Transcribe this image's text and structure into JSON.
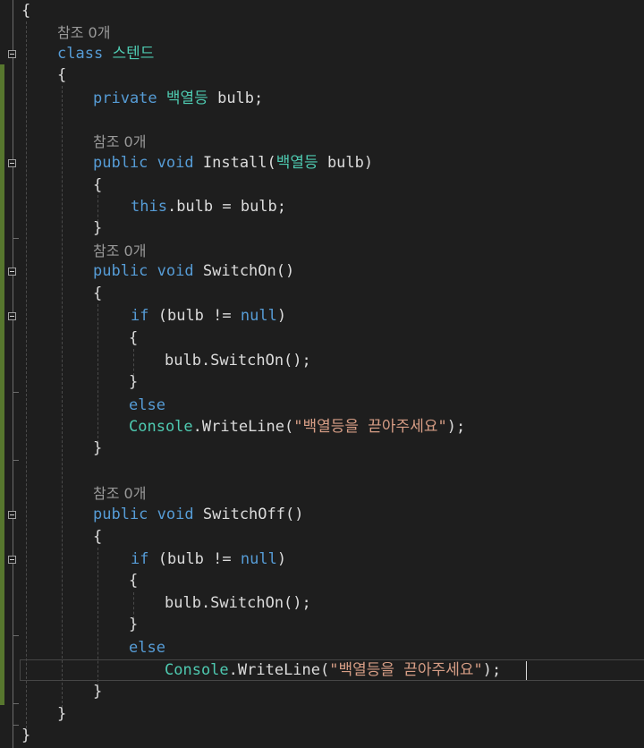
{
  "editor": {
    "codelens_text": "참조 0개",
    "lines": [
      {
        "text": "{"
      },
      {
        "text": "참조 0개"
      },
      {
        "text": "class 스텐드"
      },
      {
        "text": "{"
      },
      {
        "text": "private 백열등 bulb;"
      },
      {
        "text": ""
      },
      {
        "text": "참조 0개"
      },
      {
        "text": "public void Install(백열등 bulb)"
      },
      {
        "text": "{"
      },
      {
        "text": "this.bulb = bulb;"
      },
      {
        "text": "}"
      },
      {
        "text": "참조 0개"
      },
      {
        "text": "public void SwitchOn()"
      },
      {
        "text": "{"
      },
      {
        "text": "if (bulb != null)"
      },
      {
        "text": "{"
      },
      {
        "text": "bulb.SwitchOn();"
      },
      {
        "text": "}"
      },
      {
        "text": "else"
      },
      {
        "text": "Console.WriteLine(\"백열등을 끋아주세요\");"
      },
      {
        "text": "}"
      },
      {
        "text": ""
      },
      {
        "text": "참조 0개"
      },
      {
        "text": "public void SwitchOff()"
      },
      {
        "text": "{"
      },
      {
        "text": "if (bulb != null)"
      },
      {
        "text": "{"
      },
      {
        "text": "bulb.SwitchOn();"
      },
      {
        "text": "}"
      },
      {
        "text": "else"
      },
      {
        "text": "Console.WriteLine(\"백열등을 끋아주세요\");"
      },
      {
        "text": "}"
      },
      {
        "text": "}"
      },
      {
        "text": "}"
      }
    ],
    "tokens": {
      "L0": "{",
      "L1_ref": "참조 0개",
      "L2_class": "class",
      "L2_name": "스텐드",
      "L3": "{",
      "L4_private": "private",
      "L4_type": "백열등",
      "L4_rest": "bulb;",
      "L6_ref": "참조 0개",
      "L7_public": "public",
      "L7_void": "void",
      "L7_name": "Install(",
      "L7_type": "백열등",
      "L7_rest": "bulb)",
      "L8": "{",
      "L9_this": "this",
      "L9_rest": ".bulb = bulb;",
      "L10": "}",
      "L11_ref": "참조 0개",
      "L12_public": "public",
      "L12_void": "void",
      "L12_name": "SwitchOn()",
      "L13": "{",
      "L14_if": "if",
      "L14_mid": "(bulb !=",
      "L14_null": "null",
      "L14_end": ")",
      "L15": "{",
      "L16": "bulb.SwitchOn();",
      "L17": "}",
      "L18_else": "else",
      "L19_console": "Console",
      "L19_mid": ".WriteLine(",
      "L19_str": "\"백열등을 끋아주세요\"",
      "L19_end": ");",
      "L20": "}",
      "L22_ref": "참조 0개",
      "L23_public": "public",
      "L23_void": "void",
      "L23_name": "SwitchOff()",
      "L24": "{",
      "L25_if": "if",
      "L25_mid": "(bulb !=",
      "L25_null": "null",
      "L25_end": ")",
      "L26": "{",
      "L27": "bulb.SwitchOn();",
      "L28": "}",
      "L29_else": "else",
      "L30_console": "Console",
      "L30_mid": ".WriteLine(",
      "L30_str": "\"백열등을 끋아주세요\"",
      "L30_end": ");",
      "L31": "}",
      "L32": "}",
      "L33": "}"
    }
  },
  "colors": {
    "background": "#1e1e1e",
    "keyword": "#569cd6",
    "type": "#4ec9b0",
    "string": "#d69d85",
    "plain": "#dcdcdc",
    "codelens": "#999999",
    "change_bar": "#57772e"
  }
}
